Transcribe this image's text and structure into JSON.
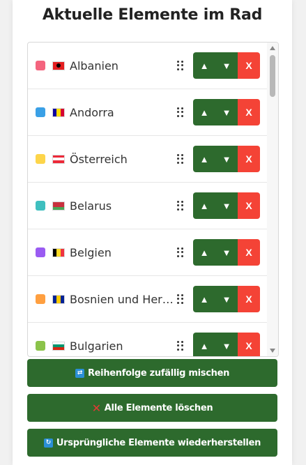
{
  "title": "Aktuelle Elemente im Rad",
  "items": [
    {
      "name": "Albanien",
      "color": "#f4647e",
      "flag": {
        "dir": "v",
        "stripes": [
          "#e41e20",
          "#e41e20"
        ],
        "emblem": "#000000"
      }
    },
    {
      "name": "Andorra",
      "color": "#3aa0e6",
      "flag": {
        "dir": "v",
        "stripes": [
          "#10069f",
          "#fedd00",
          "#d50032"
        ]
      }
    },
    {
      "name": "Österreich",
      "color": "#fdd54a",
      "flag": {
        "dir": "h",
        "stripes": [
          "#ed2939",
          "#ffffff",
          "#ed2939"
        ]
      }
    },
    {
      "name": "Belarus",
      "color": "#3fbfbf",
      "flag": {
        "dir": "h",
        "stripes": [
          "#c8313e",
          "#c8313e",
          "#4aa657"
        ]
      }
    },
    {
      "name": "Belgien",
      "color": "#9a5bf2",
      "flag": {
        "dir": "v",
        "stripes": [
          "#000000",
          "#fdda24",
          "#ef3340"
        ]
      }
    },
    {
      "name": "Bosnien und Herzegowina",
      "color": "#ff9f40",
      "flag": {
        "dir": "v",
        "stripes": [
          "#002395",
          "#fecb00",
          "#002395"
        ]
      }
    },
    {
      "name": "Bulgarien",
      "color": "#8bc34a",
      "flag": {
        "dir": "h",
        "stripes": [
          "#ffffff",
          "#00966e",
          "#d62612"
        ]
      }
    }
  ],
  "buttons": {
    "up": "▲",
    "down": "▼",
    "delete": "X"
  },
  "actions": {
    "shuffle": {
      "icon": "shuffle-icon",
      "label": "Reihenfolge zufällig mischen"
    },
    "clear": {
      "icon": "cross-icon",
      "label": "Alle Elemente löschen"
    },
    "restore": {
      "icon": "restore-icon",
      "label": "Ursprüngliche Elemente wiederherstellen"
    }
  }
}
